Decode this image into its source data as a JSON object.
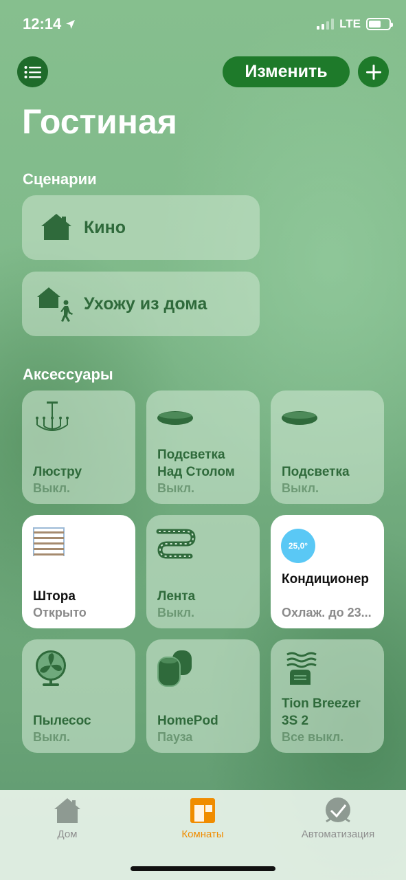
{
  "status_bar": {
    "time": "12:14",
    "network": "LTE",
    "battery_level": 0.62,
    "location_icon": "location-arrow-icon"
  },
  "header": {
    "edit_label": "Изменить",
    "menu_icon": "list-icon",
    "add_icon": "plus-icon"
  },
  "room": {
    "title": "Гостиная"
  },
  "scenes": {
    "title": "Сценарии",
    "items": [
      {
        "label": "Кино",
        "icon": "home-icon"
      },
      {
        "label": "Ухожу из дома",
        "icon": "leave-home-icon"
      }
    ]
  },
  "accessories": {
    "title": "Аксессуары",
    "items": [
      {
        "name": "Люстру",
        "status": "Выкл.",
        "icon": "chandelier-icon",
        "on": false
      },
      {
        "name": "Подсветка Над Столом",
        "status": "Выкл.",
        "icon": "light-strip-oval-icon",
        "on": false
      },
      {
        "name": "Подсветка",
        "status": "Выкл.",
        "icon": "light-strip-oval-icon",
        "on": false
      },
      {
        "name": "Штора",
        "status": "Открыто",
        "icon": "blinds-icon",
        "on": true
      },
      {
        "name": "Лента",
        "status": "Выкл.",
        "icon": "led-tape-icon",
        "on": false
      },
      {
        "name": "Кондиционер",
        "status": "Охлаж. до 23...",
        "badge": "25,0°",
        "icon": "thermostat-icon",
        "on": true
      },
      {
        "name": "Пылесос",
        "status": "Выкл.",
        "icon": "fan-icon",
        "on": false
      },
      {
        "name": "HomePod",
        "status": "Пауза",
        "icon": "homepod-icon",
        "on": false
      },
      {
        "name": "Tion Breezer 3S 2",
        "status": "Все выкл.",
        "icon": "air-purifier-icon",
        "on": false
      }
    ]
  },
  "tabbar": {
    "items": [
      {
        "label": "Дом",
        "icon": "house-icon",
        "active": false
      },
      {
        "label": "Комнаты",
        "icon": "rooms-icon",
        "active": true
      },
      {
        "label": "Автоматизация",
        "icon": "clock-icon",
        "active": false
      }
    ],
    "active_color": "#f08c00"
  },
  "colors": {
    "accent_green": "#1e7a2a",
    "tile_text": "#2f6a3b",
    "badge_blue": "#5ac8f5"
  }
}
